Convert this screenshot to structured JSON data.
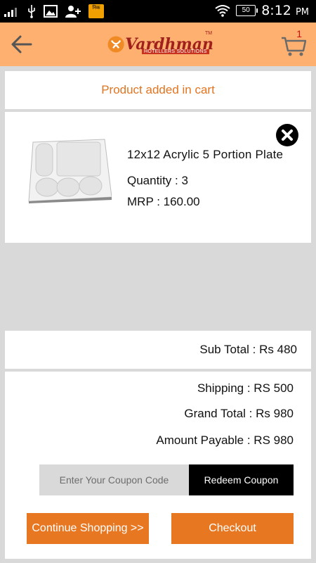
{
  "status_bar": {
    "time": "8:12",
    "ampm": "PM",
    "battery": "50",
    "app_icon_text": "निक"
  },
  "header": {
    "brand": "Vardhman",
    "brand_sub": "HOTELLERS SOLUTIONS",
    "brand_tm": "TM",
    "cart_count": "1",
    "icons": [
      "back-arrow-icon",
      "cart-icon"
    ],
    "colors": {
      "appbar": "#fdb06f",
      "accent": "#e87722"
    }
  },
  "notice": "Product added in cart",
  "product": {
    "name": "12x12 Acrylic 5 Portion Plate",
    "quantity": "Quantity : 3",
    "mrp": "MRP : 160.00"
  },
  "summary": {
    "sub_total": "Sub Total : Rs 480",
    "shipping": "Shipping : RS 500",
    "grand_total": "Grand Total : Rs 980",
    "amount_payable": "Amount Payable : RS 980"
  },
  "coupon": {
    "placeholder": "Enter Your Coupon Code",
    "button": "Redeem Coupon"
  },
  "actions": {
    "continue": "Continue Shopping >>",
    "checkout": "Checkout"
  }
}
